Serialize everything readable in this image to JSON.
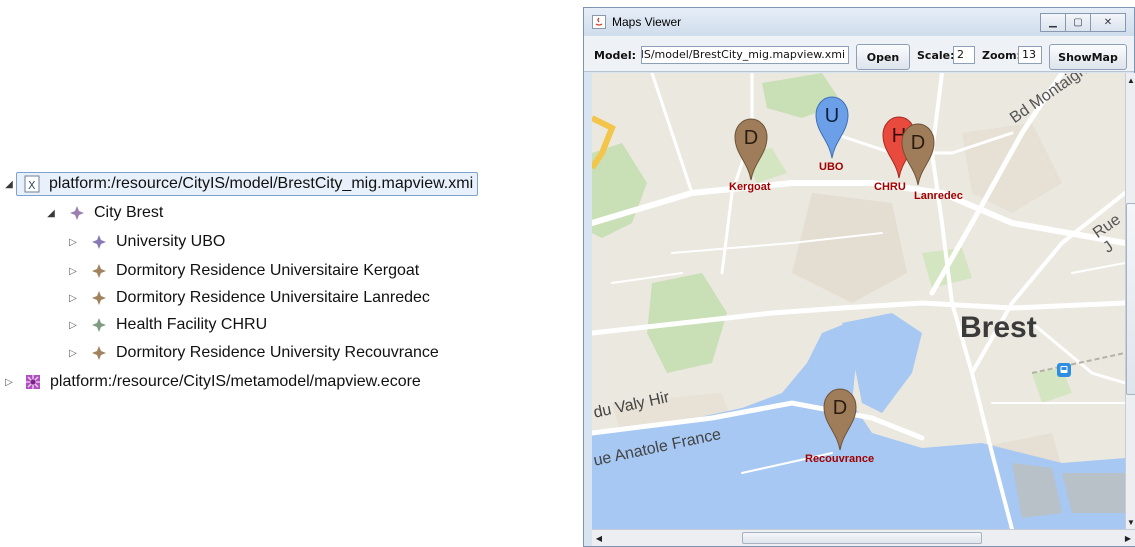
{
  "tree": {
    "root_file": "platform:/resource/CityIS/model/BrestCity_mig.mapview.xmi",
    "city": "City Brest",
    "children": [
      "University UBO",
      "Dormitory Residence Universitaire Kergoat",
      "Dormitory Residence Universitaire Lanredec",
      "Health Facility CHRU",
      "Dormitory Residence University Recouvrance"
    ],
    "second_file": "platform:/resource/CityIS/metamodel/mapview.ecore"
  },
  "window": {
    "title": "Maps Viewer",
    "model_label": "Model:",
    "model_value": "CityIS/model/BrestCity_mig.mapview.xmi",
    "open_label": "Open",
    "scale_label": "Scale:",
    "scale_value": "2",
    "zoom_label": "Zoom:",
    "zoom_value": "13",
    "showmap_label": "ShowMap"
  },
  "map": {
    "city_label": "Brest",
    "streets": {
      "bd_montaigne": "Bd Montaigne",
      "rue": "Rue J",
      "du_valy": "du Valy Hir",
      "anatole": "ue Anatole France"
    },
    "markers": [
      {
        "letter": "D",
        "label": "Kergoat",
        "color": "#a07d5a"
      },
      {
        "letter": "U",
        "label": "UBO",
        "color": "#6b9fe8"
      },
      {
        "letter": "H",
        "label": "CHRU",
        "color": "#e84a3e"
      },
      {
        "letter": "D",
        "label": "Lanredec",
        "color": "#a07d5a"
      },
      {
        "letter": "D",
        "label": "Recouvrance",
        "color": "#a07d5a"
      }
    ]
  }
}
